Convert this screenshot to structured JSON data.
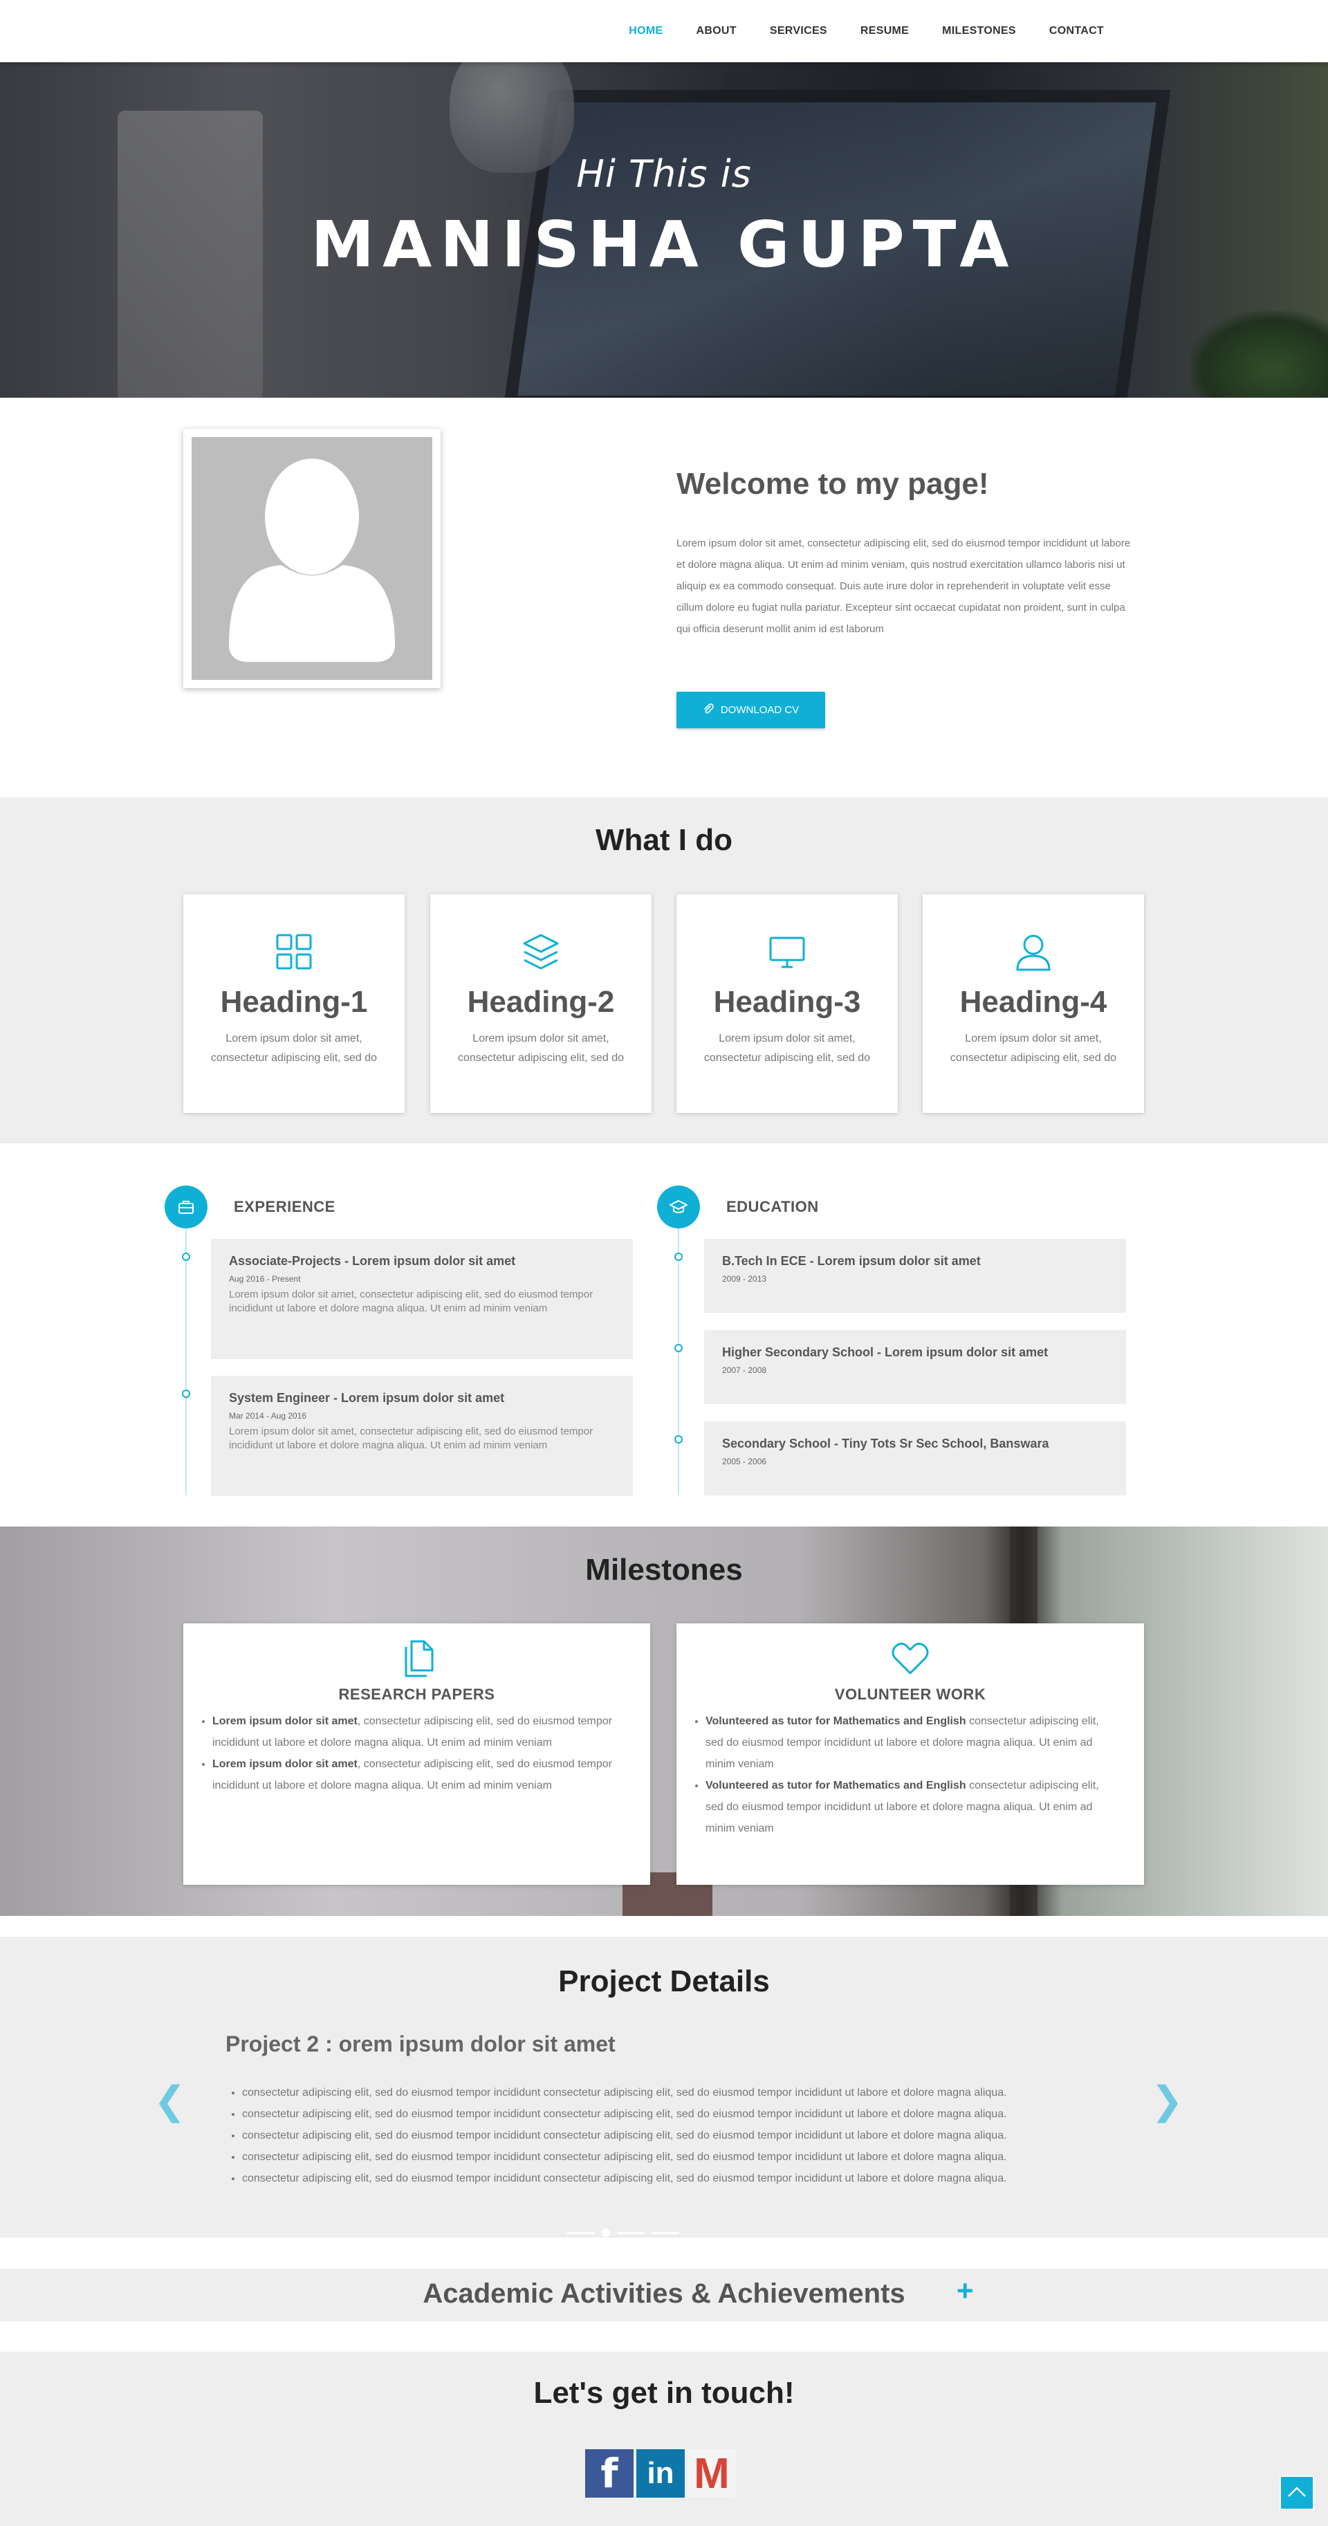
{
  "nav": {
    "items": [
      "HOME",
      "ABOUT",
      "SERVICES",
      "RESUME",
      "MILESTONES",
      "CONTACT"
    ],
    "active": "HOME"
  },
  "hero": {
    "greeting": "Hi This is",
    "name": "MANISHA GUPTA"
  },
  "about": {
    "title": "Welcome to my page!",
    "text": "Lorem ipsum dolor sit amet, consectetur adipiscing elit, sed do eiusmod tempor incididunt ut labore et dolore magna aliqua. Ut enim ad minim veniam, quis nostrud exercitation ullamco laboris nisi ut aliquip ex ea commodo consequat. Duis aute irure dolor in reprehenderit in voluptate velit esse cillum dolore eu fugiat nulla pariatur. Excepteur sint occaecat cupidatat non proident, sunt in culpa qui officia deserunt mollit anim id est laborum",
    "button": "DOWNLOAD CV"
  },
  "services": {
    "title": "What I do",
    "cards": [
      {
        "icon": "grid-icon",
        "heading": "Heading-1",
        "text": "Lorem ipsum dolor sit amet, consectetur adipiscing elit, sed do"
      },
      {
        "icon": "layers-icon",
        "heading": "Heading-2",
        "text": "Lorem ipsum dolor sit amet, consectetur adipiscing elit, sed do"
      },
      {
        "icon": "monitor-icon",
        "heading": "Heading-3",
        "text": "Lorem ipsum dolor sit amet, consectetur adipiscing elit, sed do"
      },
      {
        "icon": "user-icon",
        "heading": "Heading-4",
        "text": "Lorem ipsum dolor sit amet, consectetur adipiscing elit, sed do"
      }
    ]
  },
  "resume": {
    "experience": {
      "label": "EXPERIENCE",
      "items": [
        {
          "title": "Associate-Projects - Lorem ipsum dolor sit amet",
          "date": "Aug 2016 - Present",
          "text": "Lorem ipsum dolor sit amet, consectetur adipiscing elit, sed do eiusmod tempor incididunt ut labore et dolore magna aliqua. Ut enim ad minim veniam"
        },
        {
          "title": "System Engineer - Lorem ipsum dolor sit amet",
          "date": "Mar 2014 - Aug 2016",
          "text": "Lorem ipsum dolor sit amet, consectetur adipiscing elit, sed do eiusmod tempor incididunt ut labore et dolore magna aliqua. Ut enim ad minim veniam"
        }
      ]
    },
    "education": {
      "label": "EDUCATION",
      "items": [
        {
          "title": "B.Tech In ECE - Lorem ipsum dolor sit amet",
          "date": "2009 - 2013"
        },
        {
          "title": "Higher Secondary School - Lorem ipsum dolor sit amet",
          "date": "2007 - 2008"
        },
        {
          "title": "Secondary School - Tiny Tots Sr Sec School, Banswara",
          "date": "2005 - 2006"
        }
      ]
    }
  },
  "milestones": {
    "title": "Milestones",
    "research": {
      "heading": "RESEARCH PAPERS",
      "items": [
        {
          "bold": "Lorem ipsum dolor sit amet",
          "text": ", consectetur adipiscing elit, sed do eiusmod tempor incididunt ut labore et dolore magna aliqua. Ut enim ad minim veniam"
        },
        {
          "bold": "Lorem ipsum dolor sit amet",
          "text": ", consectetur adipiscing elit, sed do eiusmod tempor incididunt ut labore et dolore magna aliqua. Ut enim ad minim veniam"
        }
      ]
    },
    "volunteer": {
      "heading": "VOLUNTEER WORK",
      "items": [
        {
          "bold": "Volunteered as tutor for Mathematics and English",
          "text": " consectetur adipiscing elit, sed do eiusmod tempor incididunt ut labore et dolore magna aliqua. Ut enim ad minim veniam"
        },
        {
          "bold": "Volunteered as tutor for Mathematics and English",
          "text": " consectetur adipiscing elit, sed do eiusmod tempor incididunt ut labore et dolore magna aliqua. Ut enim ad minim veniam"
        }
      ]
    }
  },
  "project": {
    "title": "Project Details",
    "heading": "Project 2 : orem ipsum dolor sit amet",
    "bullets": [
      "consectetur adipiscing elit, sed do eiusmod tempor incididunt consectetur adipiscing elit, sed do eiusmod tempor incididunt ut labore et dolore magna aliqua.",
      "consectetur adipiscing elit, sed do eiusmod tempor incididunt consectetur adipiscing elit, sed do eiusmod tempor incididunt ut labore et dolore magna aliqua.",
      "consectetur adipiscing elit, sed do eiusmod tempor incididunt consectetur adipiscing elit, sed do eiusmod tempor incididunt ut labore et dolore magna aliqua.",
      "consectetur adipiscing elit, sed do eiusmod tempor incididunt consectetur adipiscing elit, sed do eiusmod tempor incididunt ut labore et dolore magna aliqua.",
      "consectetur adipiscing elit, sed do eiusmod tempor incididunt consectetur adipiscing elit, sed do eiusmod tempor incididunt ut labore et dolore magna aliqua."
    ],
    "prev": "❮",
    "next": "❯"
  },
  "academic": {
    "title": "Academic Activities & Achievements",
    "toggle": "+"
  },
  "contact": {
    "title": "Let's get in touch!",
    "socials": [
      {
        "icon": "facebook-icon",
        "glyph": "f",
        "color": "#3b5998"
      },
      {
        "icon": "linkedin-icon",
        "glyph": "in",
        "color": "#0e76a8"
      },
      {
        "icon": "gmail-icon",
        "glyph": "M",
        "color": "#d44638"
      }
    ]
  },
  "colors": {
    "accent": "#10b0d6",
    "section_bg": "#eeeeee"
  }
}
